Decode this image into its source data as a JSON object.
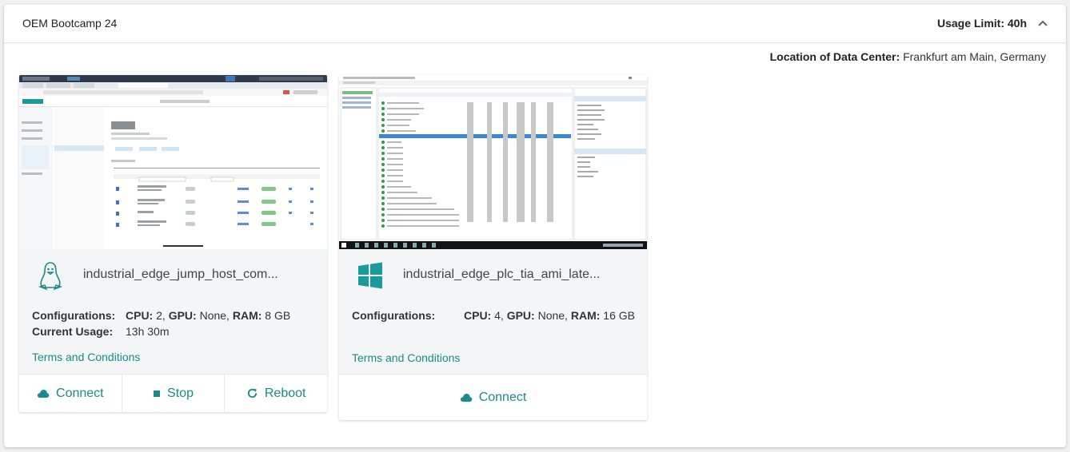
{
  "panel": {
    "title": "OEM Bootcamp 24",
    "usage_limit": "Usage Limit: 40h",
    "location_label": "Location of Data Center:",
    "location_value": "Frankfurt am Main, Germany"
  },
  "cards": [
    {
      "os_icon": "linux-tux-icon",
      "name": "industrial_edge_jump_host_com...",
      "config_label": "Configurations:",
      "cpu_label": "CPU:",
      "cpu": " 2, ",
      "gpu_label": "GPU:",
      "gpu": " None, ",
      "ram_label": "RAM:",
      "ram": " 8 GB",
      "usage_label": "Current Usage:",
      "usage_value": "13h 30m",
      "terms": "Terms and Conditions",
      "actions": [
        {
          "label": "Connect",
          "icon": "cloud-icon"
        },
        {
          "label": "Stop",
          "icon": "stop-icon"
        },
        {
          "label": "Reboot",
          "icon": "refresh-icon"
        }
      ]
    },
    {
      "os_icon": "windows-icon",
      "name": "industrial_edge_plc_tia_ami_late...",
      "config_label": "Configurations:",
      "cpu_label": "CPU:",
      "cpu": " 4, ",
      "gpu_label": "GPU:",
      "gpu": " None, ",
      "ram_label": "RAM:",
      "ram": " 16 GB",
      "terms": "Terms and Conditions",
      "actions": [
        {
          "label": "Connect",
          "icon": "cloud-icon"
        }
      ]
    }
  ],
  "colors": {
    "accent": "#1a8a8a",
    "card_bg": "#f4f5f7",
    "windows_teal": "#1a9a9a"
  }
}
